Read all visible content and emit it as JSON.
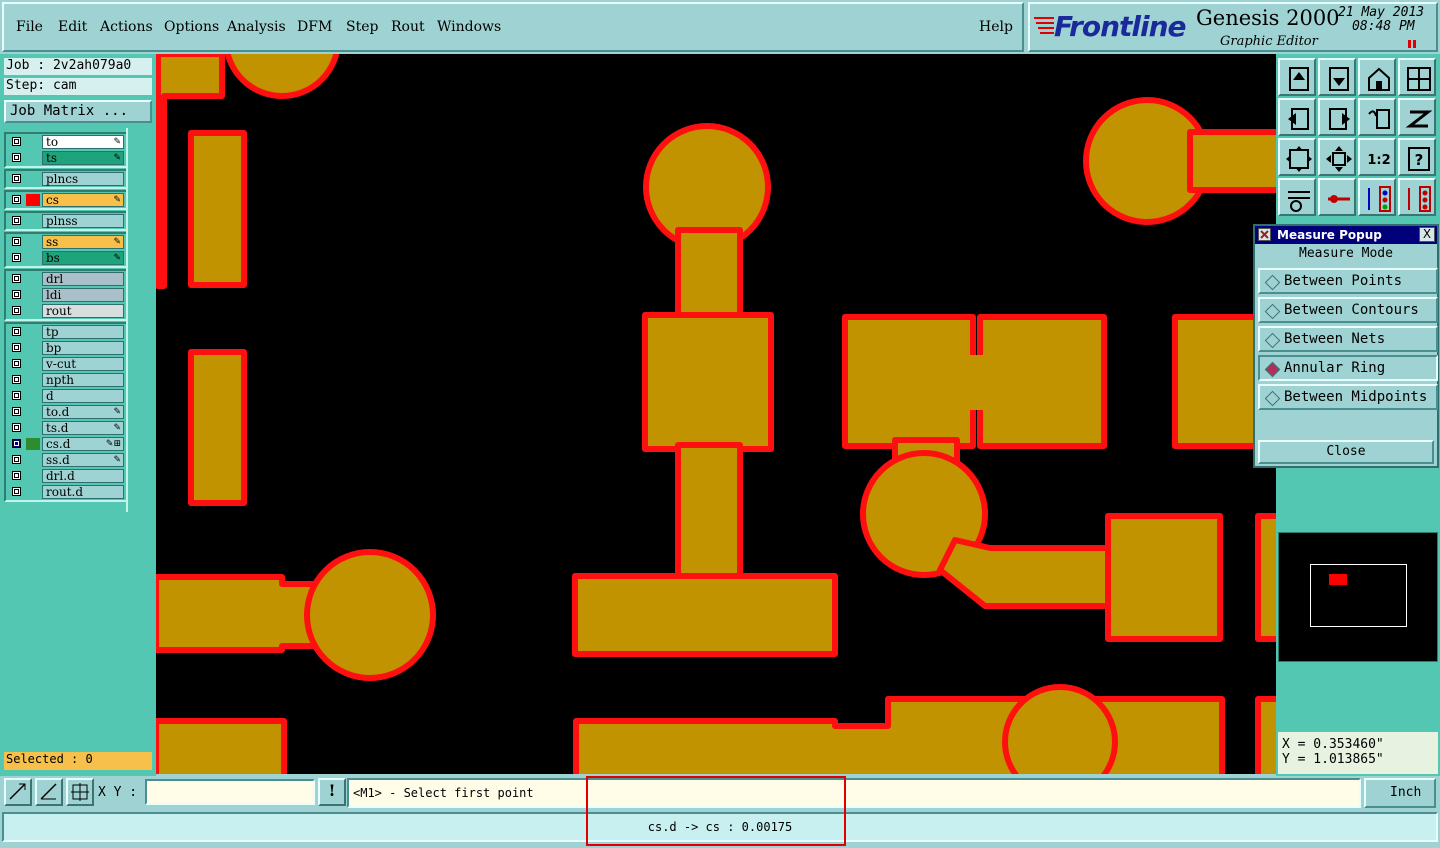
{
  "menubar": {
    "items": [
      "File",
      "Edit",
      "Actions",
      "Options",
      "Analysis",
      "DFM",
      "Step",
      "Rout",
      "Windows"
    ],
    "help": "Help"
  },
  "branding": {
    "logo": "Frontline",
    "product": "Genesis 2000",
    "subtitle": "Graphic Editor",
    "date": "21 May 2013",
    "time": "08:48 PM"
  },
  "job": {
    "job_label": "Job : 2v2ah079a0",
    "step_label": "Step: cam",
    "matrix_button": "Job Matrix ..."
  },
  "layers": {
    "group1": [
      {
        "name": "to",
        "bg": "#ffffff",
        "mark": "✎"
      },
      {
        "name": "ts",
        "bg": "#1fa37a",
        "mark": "✎"
      }
    ],
    "group2": [
      {
        "name": "plncs",
        "bg": "#9fd3d3",
        "mark": ""
      }
    ],
    "group3": [
      {
        "name": "cs",
        "bg": "#f7c04a",
        "mark": "✎",
        "swatch": "#ff0000"
      }
    ],
    "group4": [
      {
        "name": "plnss",
        "bg": "#9fd3d3",
        "mark": ""
      }
    ],
    "group5": [
      {
        "name": "ss",
        "bg": "#f7c04a",
        "mark": "✎"
      },
      {
        "name": "bs",
        "bg": "#1fa37a",
        "mark": "✎"
      }
    ],
    "group6": [
      {
        "name": "drl",
        "bg": "#a9c0c8",
        "mark": ""
      },
      {
        "name": "ldi",
        "bg": "#a9c0c8",
        "mark": ""
      },
      {
        "name": "rout",
        "bg": "#d6dede",
        "mark": ""
      }
    ],
    "group7": [
      {
        "name": "tp",
        "bg": "#9fd3d3",
        "mark": ""
      },
      {
        "name": "bp",
        "bg": "#9fd3d3",
        "mark": ""
      },
      {
        "name": "v-cut",
        "bg": "#9fd3d3",
        "mark": ""
      },
      {
        "name": "npth",
        "bg": "#9fd3d3",
        "mark": ""
      },
      {
        "name": "d",
        "bg": "#9fd3d3",
        "mark": ""
      },
      {
        "name": "to.d",
        "bg": "#9fd3d3",
        "mark": "✎"
      },
      {
        "name": "ts.d",
        "bg": "#9fd3d3",
        "mark": "✎"
      },
      {
        "name": "cs.d",
        "bg": "#9fd3d3",
        "mark": "✎⊞",
        "swatch": "#2e8b2e",
        "active": true
      },
      {
        "name": "ss.d",
        "bg": "#9fd3d3",
        "mark": "✎"
      },
      {
        "name": "drl.d",
        "bg": "#9fd3d3",
        "mark": ""
      },
      {
        "name": "rout.d",
        "bg": "#9fd3d3",
        "mark": ""
      }
    ]
  },
  "selected": "Selected : 0",
  "toolbar_icons": [
    "zoom-top-icon",
    "zoom-bottom-icon",
    "home-view-icon",
    "window-icon",
    "pan-left-icon",
    "pan-right-icon",
    "undo-view-icon",
    "redraw-icon",
    "fit-screen-icon",
    "zoom-center-icon",
    "zoom-1to2-icon",
    "help-icon",
    "settings-icon",
    "measure-icon",
    "layer-top-icon",
    "layer-bottom-icon"
  ],
  "toolbar_text": {
    "ratio": "1:2",
    "help": "?"
  },
  "measure_popup": {
    "title": "Measure Popup",
    "close_x": "X",
    "header": "Measure Mode",
    "options": [
      "Between Points",
      "Between Contours",
      "Between Nets",
      "Annular Ring",
      "Between Midpoints"
    ],
    "selected_index": 3,
    "close_button": "Close"
  },
  "coords": {
    "x": "X = 0.353460\"",
    "y": "Y = 1.013865\""
  },
  "command": {
    "xy_label": "X Y :",
    "xy_value": "",
    "excl": "!",
    "prompt": "<M1> - Select first point",
    "units": "Inch"
  },
  "status": {
    "message": "cs.d -> cs : 0.00175"
  },
  "colors": {
    "copper": "#c29300",
    "outline": "#ff1010",
    "canvas": "#000000",
    "panel": "#54c7b3",
    "chrome": "#9fd3d3",
    "title_bar": "#00007a"
  }
}
